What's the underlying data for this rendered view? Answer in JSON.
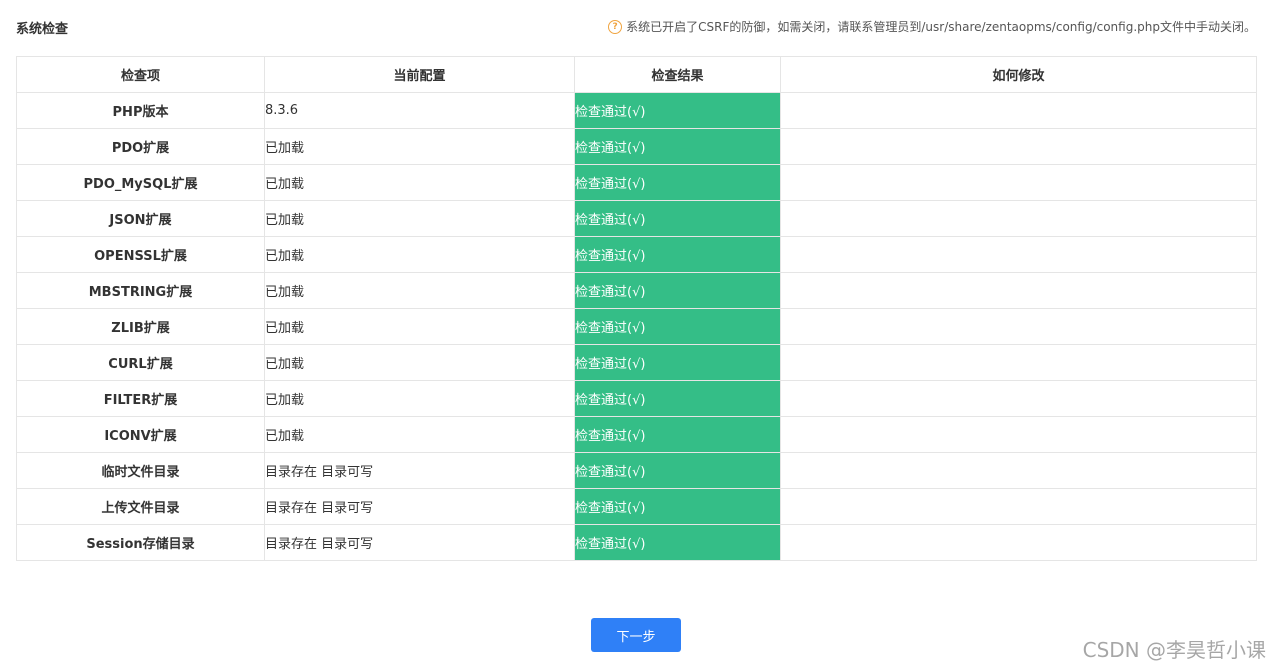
{
  "page": {
    "title": "系统检查",
    "notice": "系统已开启了CSRF的防御，如需关闭，请联系管理员到/usr/share/zentaopms/config/config.php文件中手动关闭。",
    "help_icon": "question-circle-icon"
  },
  "table": {
    "headers": [
      "检查项",
      "当前配置",
      "检查结果",
      "如何修改"
    ],
    "rows": [
      {
        "item": "PHP版本",
        "current": "8.3.6",
        "result": "检查通过(√)",
        "fix": ""
      },
      {
        "item": "PDO扩展",
        "current": "已加载",
        "result": "检查通过(√)",
        "fix": ""
      },
      {
        "item": "PDO_MySQL扩展",
        "current": "已加载",
        "result": "检查通过(√)",
        "fix": ""
      },
      {
        "item": "JSON扩展",
        "current": "已加载",
        "result": "检查通过(√)",
        "fix": ""
      },
      {
        "item": "OPENSSL扩展",
        "current": "已加载",
        "result": "检查通过(√)",
        "fix": ""
      },
      {
        "item": "MBSTRING扩展",
        "current": "已加载",
        "result": "检查通过(√)",
        "fix": ""
      },
      {
        "item": "ZLIB扩展",
        "current": "已加载",
        "result": "检查通过(√)",
        "fix": ""
      },
      {
        "item": "CURL扩展",
        "current": "已加载",
        "result": "检查通过(√)",
        "fix": ""
      },
      {
        "item": "FILTER扩展",
        "current": "已加载",
        "result": "检查通过(√)",
        "fix": ""
      },
      {
        "item": "ICONV扩展",
        "current": "已加载",
        "result": "检查通过(√)",
        "fix": ""
      },
      {
        "item": "临时文件目录",
        "current": "目录存在 目录可写",
        "result": "检查通过(√)",
        "fix": ""
      },
      {
        "item": "上传文件目录",
        "current": "目录存在 目录可写",
        "result": "检查通过(√)",
        "fix": ""
      },
      {
        "item": "Session存储目录",
        "current": "目录存在 目录可写",
        "result": "检查通过(√)",
        "fix": ""
      }
    ]
  },
  "actions": {
    "next_label": "下一步"
  },
  "watermark": "CSDN @李昊哲小课",
  "colors": {
    "pass_green": "#34be87",
    "primary_blue": "#2f80f7",
    "help_orange": "#f0a440"
  }
}
